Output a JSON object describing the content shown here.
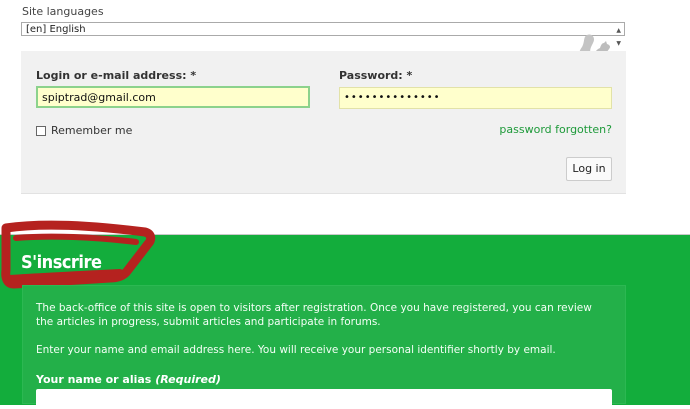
{
  "language": {
    "label": "Site languages",
    "selected": "[en] English"
  },
  "login": {
    "login_label": "Login or e-mail address: *",
    "login_value": "spiptrad@gmail.com",
    "password_label": "Password: *",
    "password_value": "••••••••••••••",
    "remember_label": "Remember me",
    "forgot_link": "password forgotten?",
    "login_button": "Log in"
  },
  "register": {
    "title": "S'inscrire",
    "intro": "The back-office of this site is open to visitors after registration. Once you have registered, you can review the articles in progress, submit articles and participate in forums.",
    "instruction": "Enter your name and email address here. You will receive your personal identifier shortly by email.",
    "name_label": "Your name or alias",
    "name_required": "(Required)",
    "name_value": ""
  },
  "colors": {
    "brand_green": "#13ad3c",
    "link_green": "#1e9a3a",
    "autofill_yellow": "#ffffcc",
    "annotation_red": "#b5221f"
  },
  "icons": [
    "squirrel-logo-icon",
    "chevron-down-icon",
    "checkbox-icon"
  ]
}
